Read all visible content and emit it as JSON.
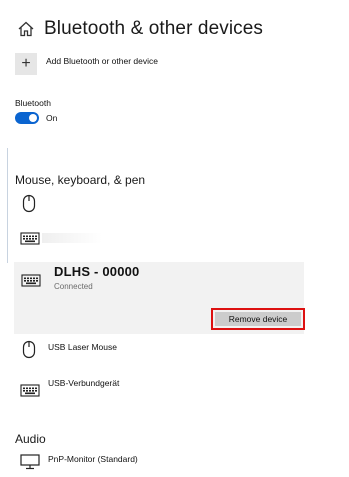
{
  "header": {
    "title": "Bluetooth & other devices",
    "icon": "home-icon"
  },
  "add_device": {
    "button_symbol": "+",
    "label": "Add Bluetooth or other device"
  },
  "bluetooth": {
    "label": "Bluetooth",
    "state": "On",
    "on": true,
    "accent": "#0a64d0"
  },
  "sections": {
    "mouse_keyboard_pen": "Mouse, keyboard, & pen",
    "audio": "Audio"
  },
  "devices": {
    "selected": {
      "name": "DLHS - 00000",
      "status": "Connected",
      "remove_label": "Remove device",
      "highlight_color": "#d11111"
    },
    "usb_mouse": "USB Laser Mouse",
    "usb_device": "USB-Verbundgerät",
    "monitor": "PnP-Monitor (Standard)"
  }
}
